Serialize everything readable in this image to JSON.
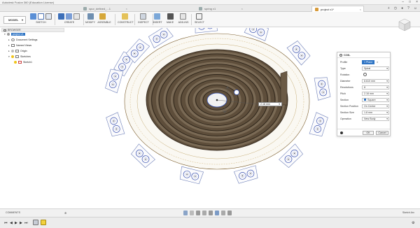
{
  "window": {
    "title": "Autodesk Fusion 360 (Education License)"
  },
  "tabs": [
    {
      "label": "spur_defined_...1",
      "active": false
    },
    {
      "label": "spring v1",
      "active": false
    },
    {
      "label": "project v1*",
      "active": true
    }
  ],
  "toolbar": {
    "workspace": "MODEL",
    "groups": [
      "SKETCH",
      "CREATE",
      "MODIFY",
      "ASSEMBLE",
      "CONSTRUCT",
      "INSPECT",
      "INSERT",
      "MAKE",
      "ADD-INS",
      "SELECT"
    ]
  },
  "browser": {
    "title": "BROWSER",
    "nodes": [
      {
        "label": "project v1",
        "selected": true
      },
      {
        "label": "Document Settings"
      },
      {
        "label": "Named Views"
      },
      {
        "label": "Origin"
      },
      {
        "label": "Sketches"
      },
      {
        "label": "Sketch1"
      }
    ]
  },
  "coil_panel": {
    "title": "COIL",
    "rows": [
      {
        "label": "Profile",
        "value": "1 Plane"
      },
      {
        "label": "Type",
        "value": "Spiral"
      },
      {
        "label": "Rotation",
        "value": ""
      },
      {
        "label": "Diameter",
        "value": "8.610 mm"
      },
      {
        "label": "Revolutions",
        "value": "8"
      },
      {
        "label": "Pitch",
        "value": "2.16 mm"
      },
      {
        "label": "Section",
        "value": "Square"
      },
      {
        "label": "Section Position",
        "value": "On Center"
      },
      {
        "label": "Section Size",
        "value": "1.8 mm"
      },
      {
        "label": "Operation",
        "value": "New Body"
      }
    ],
    "ok_label": "OK",
    "cancel_label": "Cancel"
  },
  "dimension_input": {
    "value": "2.16 mm"
  },
  "navbar": {
    "comments": "COMMENTS",
    "sketch_label": "Sketch Arc"
  },
  "colors": {
    "accent": "#2e74c4",
    "coil": "#6b5a45",
    "coil_edge": "#3f3326",
    "sketch": "#2f4fb5"
  }
}
